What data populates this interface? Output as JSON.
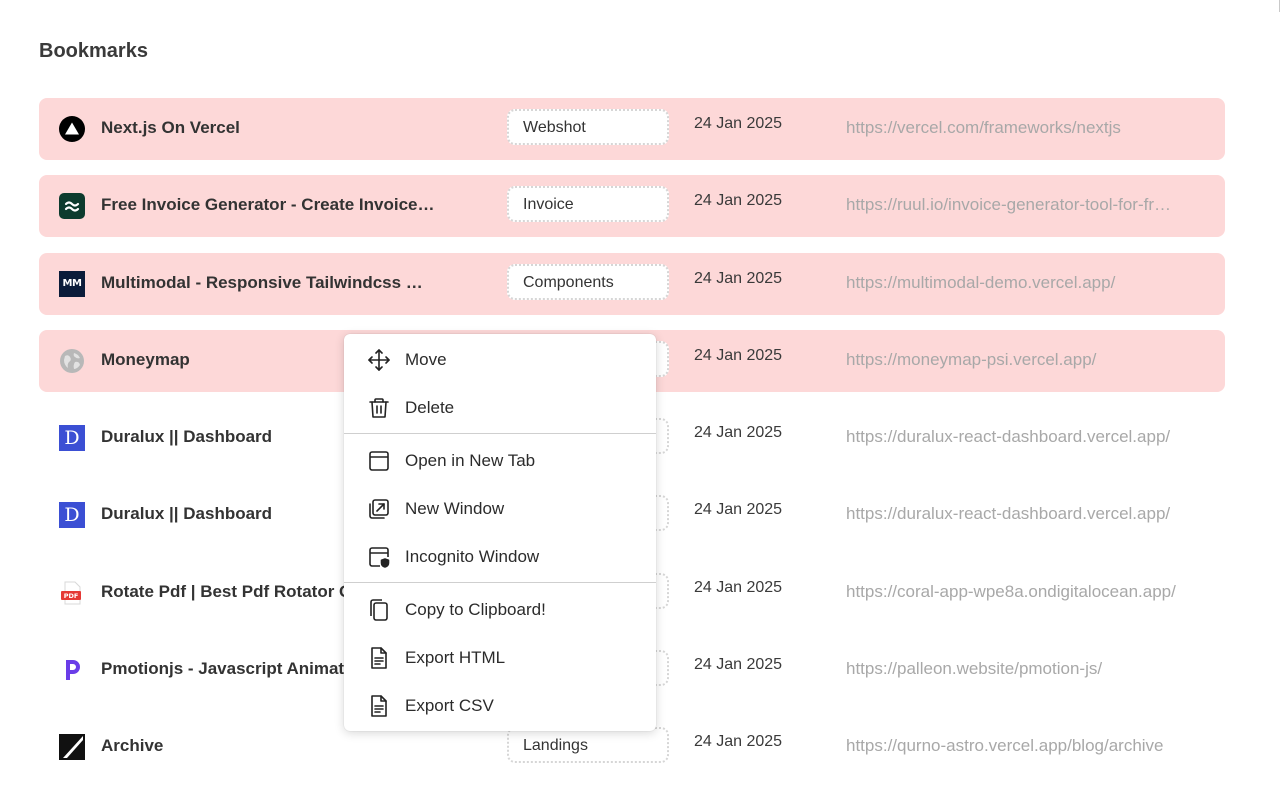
{
  "page": {
    "title": "Bookmarks"
  },
  "bookmarks": [
    {
      "favicon": "vercel-icon",
      "title": "Next.js On Vercel",
      "tag": "Webshot",
      "date": "24 Jan 2025",
      "url": "https://vercel.com/frameworks/nextjs",
      "selected": true
    },
    {
      "favicon": "ruul-icon",
      "title": "Free Invoice Generator - Create Invoices Online",
      "tag": "Invoice",
      "date": "24 Jan 2025",
      "url": "https://ruul.io/invoice-generator-tool-for-freelancers",
      "selected": true
    },
    {
      "favicon": "multimodal-icon",
      "title": "Multimodal - Responsive Tailwindcss Modals",
      "tag": "Components",
      "date": "24 Jan 2025",
      "url": "https://multimodal-demo.vercel.app/",
      "selected": true
    },
    {
      "favicon": "globe-icon",
      "title": "Moneymap",
      "tag": "",
      "date": "24 Jan 2025",
      "url": "https://moneymap-psi.vercel.app/",
      "selected": true
    },
    {
      "favicon": "duralux-icon",
      "title": "Duralux || Dashboard",
      "tag": "",
      "date": "24 Jan 2025",
      "url": "https://duralux-react-dashboard.vercel.app/",
      "selected": false
    },
    {
      "favicon": "duralux-icon",
      "title": "Duralux || Dashboard",
      "tag": "",
      "date": "24 Jan 2025",
      "url": "https://duralux-react-dashboard.vercel.app/",
      "selected": false
    },
    {
      "favicon": "pdf-icon",
      "title": "Rotate Pdf | Best Pdf Rotator Online",
      "tag": "",
      "date": "24 Jan 2025",
      "url": "https://coral-app-wpe8a.ondigitalocean.app/",
      "selected": false
    },
    {
      "favicon": "pmotion-icon",
      "title": "Pmotionjs - Javascript Animate",
      "tag": "",
      "date": "24 Jan 2025",
      "url": "https://palleon.website/pmotion-js/",
      "selected": false
    },
    {
      "favicon": "archive-icon",
      "title": "Archive",
      "tag": "Landings",
      "date": "24 Jan 2025",
      "url": "https://qurno-astro.vercel.app/blog/archive",
      "selected": false
    }
  ],
  "context_menu": {
    "groups": [
      [
        {
          "icon": "move-icon",
          "label": "Move"
        },
        {
          "icon": "trash-icon",
          "label": "Delete"
        }
      ],
      [
        {
          "icon": "new-tab-icon",
          "label": "Open in New Tab"
        },
        {
          "icon": "new-window-icon",
          "label": "New Window"
        },
        {
          "icon": "incognito-window-icon",
          "label": "Incognito Window"
        }
      ],
      [
        {
          "icon": "copy-icon",
          "label": "Copy to Clipboard!"
        },
        {
          "icon": "document-icon",
          "label": "Export HTML"
        },
        {
          "icon": "document-icon",
          "label": "Export CSV"
        }
      ]
    ]
  }
}
